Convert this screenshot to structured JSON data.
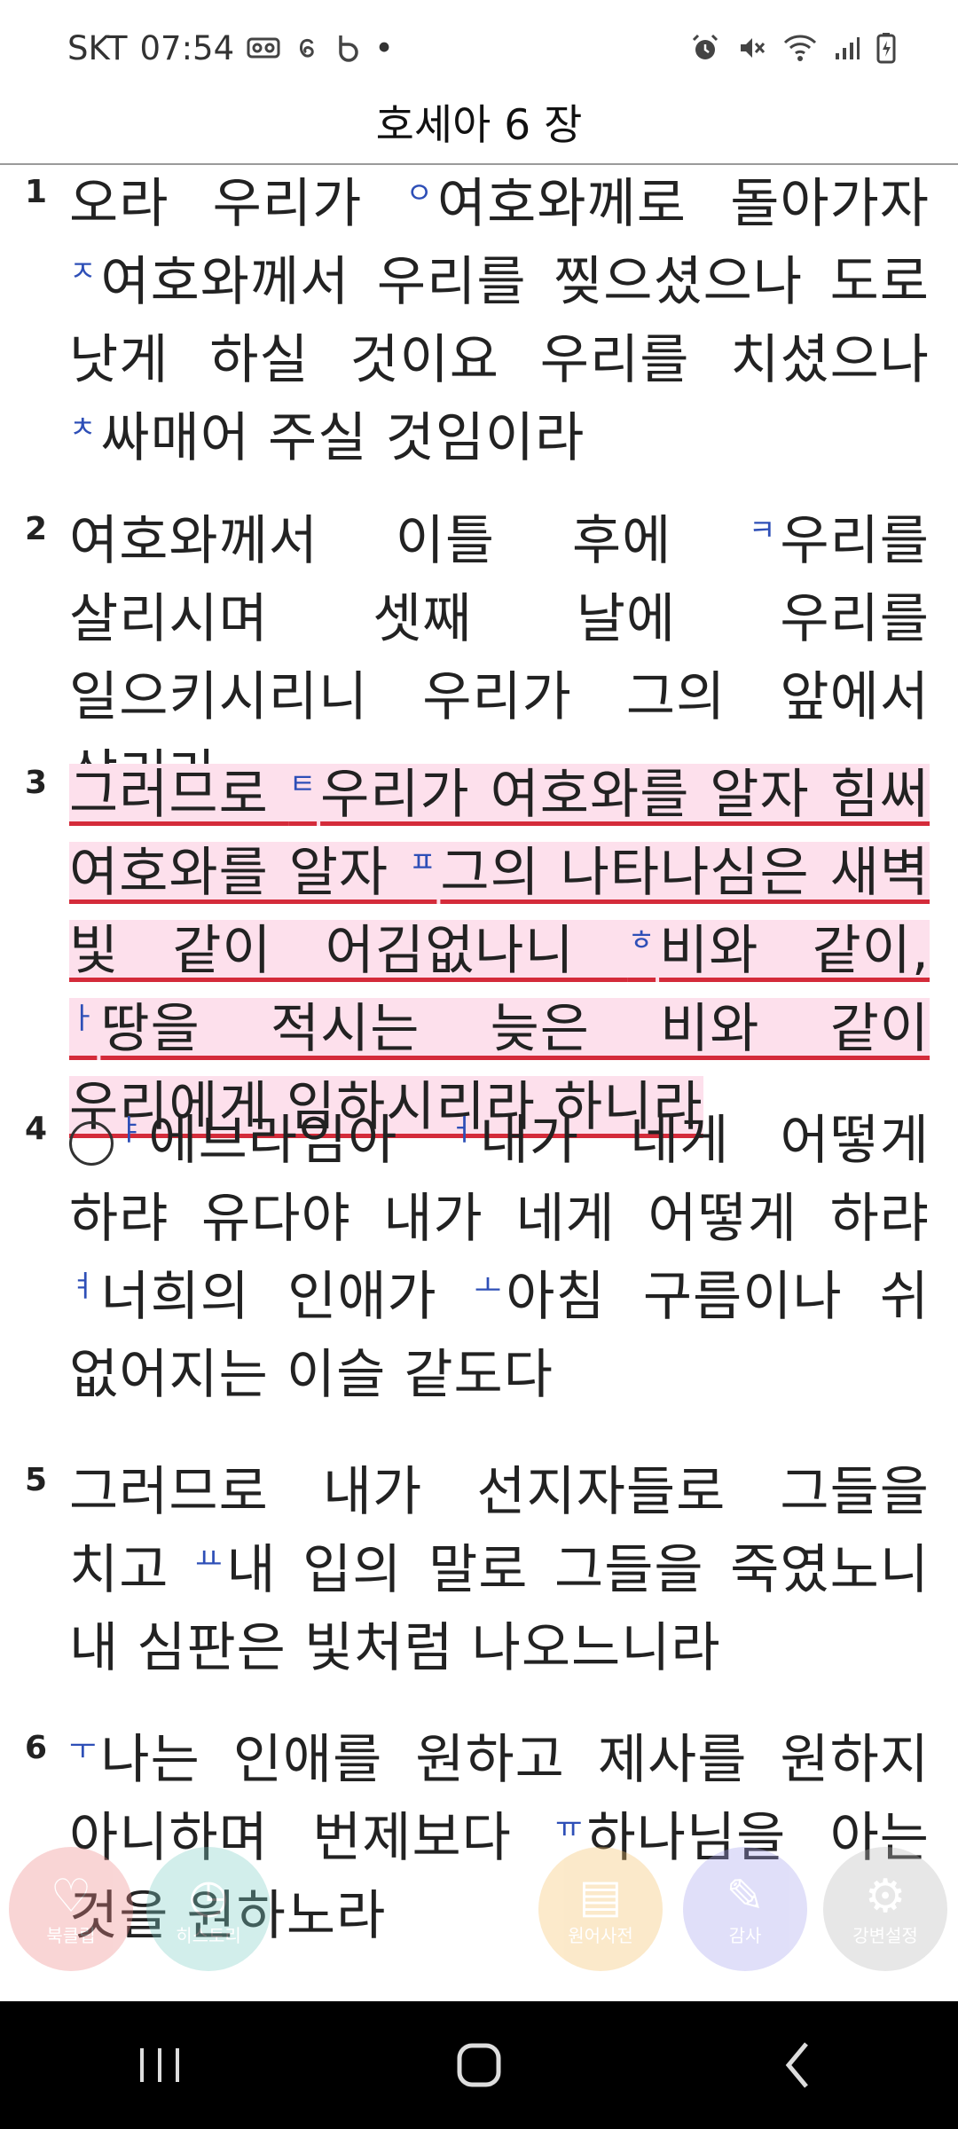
{
  "status_bar": {
    "carrier": "SKT",
    "time": "07:54",
    "dot": "•"
  },
  "header": {
    "title": "호세아 6 장"
  },
  "verses": [
    {
      "number": "1",
      "parts": [
        {
          "t": "오라 우리가 "
        },
        {
          "m": "ㅇ"
        },
        {
          "t": "여호와께로 돌아가자 "
        },
        {
          "m": "ㅈ"
        },
        {
          "t": "여호와께서 우리를 찢으셨으나 도로 낫게 하실 것이요 우리를 치셨으나 "
        },
        {
          "m": "ㅊ"
        },
        {
          "t": "싸매어 주실 것임이라"
        }
      ]
    },
    {
      "number": "2",
      "parts": [
        {
          "t": "여호와께서 이틀 후에 "
        },
        {
          "m": "ㅋ"
        },
        {
          "t": "우리를 살리시며 셋째 날에 우리를 일으키시리니 우리가 그의 앞에서 살리라"
        }
      ]
    },
    {
      "number": "3",
      "highlighted": true,
      "parts": [
        {
          "t": "그러므로 "
        },
        {
          "m": "ㅌ"
        },
        {
          "t": "우리가 여호와를 알자 힘써 여호와를 알자 "
        },
        {
          "m": "ㅍ"
        },
        {
          "t": "그의 나타나심은 새벽 빛 같이 어김없나니 "
        },
        {
          "m": "ㅎ"
        },
        {
          "t": "비와 같이, "
        },
        {
          "m": "ㅏ"
        },
        {
          "t": "땅을 적시는 늦은 비와 같이 우리에게 임하시리라 하니라"
        }
      ]
    },
    {
      "number": "4",
      "parts": [
        {
          "c": "○"
        },
        {
          "m": "ㅑ"
        },
        {
          "t": "에브라임아 "
        },
        {
          "m": "ㅓ"
        },
        {
          "t": "내가 네게 어떻게 하랴 유다야 내가 네게 어떻게 하랴 "
        },
        {
          "m": "ㅕ"
        },
        {
          "t": "너희의 인애가 "
        },
        {
          "m": "ㅗ"
        },
        {
          "t": "아침 구름이나 쉬 없어지는 이슬 같도다"
        }
      ]
    },
    {
      "number": "5",
      "parts": [
        {
          "t": "그러므로 내가 선지자들로 그들을 치고 "
        },
        {
          "m": "ㅛ"
        },
        {
          "t": "내 입의 말로 그들을 죽였노니 내 심판은 빛처럼 나오느니라"
        }
      ]
    },
    {
      "number": "6",
      "parts": [
        {
          "m": "ㅜ"
        },
        {
          "t": "나는 인애를 원하고 제사를 원하지 아니하며 번제보다 "
        },
        {
          "m": "ㅠ"
        },
        {
          "t": "하나님을 아는 것을 원하노라"
        }
      ]
    }
  ],
  "floating_buttons": [
    {
      "label": "북클립",
      "icon": "bookmark-icon",
      "color": "#ef8a8a"
    },
    {
      "label": "히스토리",
      "icon": "history-icon",
      "color": "#7fd1c8"
    },
    {
      "label": "원어사전",
      "icon": "dictionary-icon",
      "color": "#f6c26b"
    },
    {
      "label": "감사",
      "icon": "gratitude-icon",
      "color": "#a9a6ee"
    },
    {
      "label": "강변설정",
      "icon": "settings-icon",
      "color": "#bdbdbd"
    }
  ],
  "colors": {
    "highlight_bg": "#fde0ec",
    "underline": "#d42b3a",
    "footnote_mark": "#2e4fb7"
  }
}
